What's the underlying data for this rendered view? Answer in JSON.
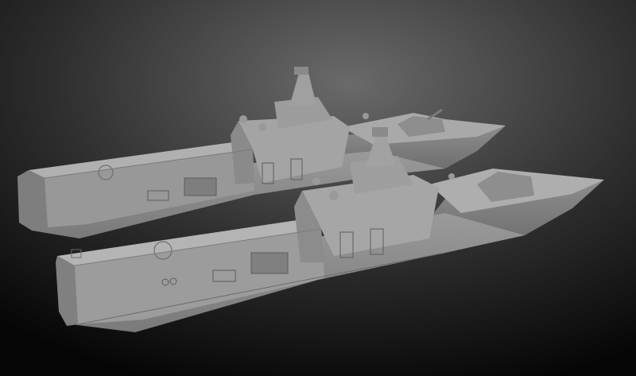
{
  "scene": {
    "subject": "two-stealth-corvette-3d-models",
    "colors": {
      "bg_light": "#6a6a6a",
      "bg_dark": "#050505",
      "hull_light": "#a8a8a8",
      "hull_mid": "#8c8c8c",
      "hull_dark": "#6e6e6e",
      "hull_shadow": "#4e4e4e",
      "line": "#5c5c5c"
    }
  }
}
